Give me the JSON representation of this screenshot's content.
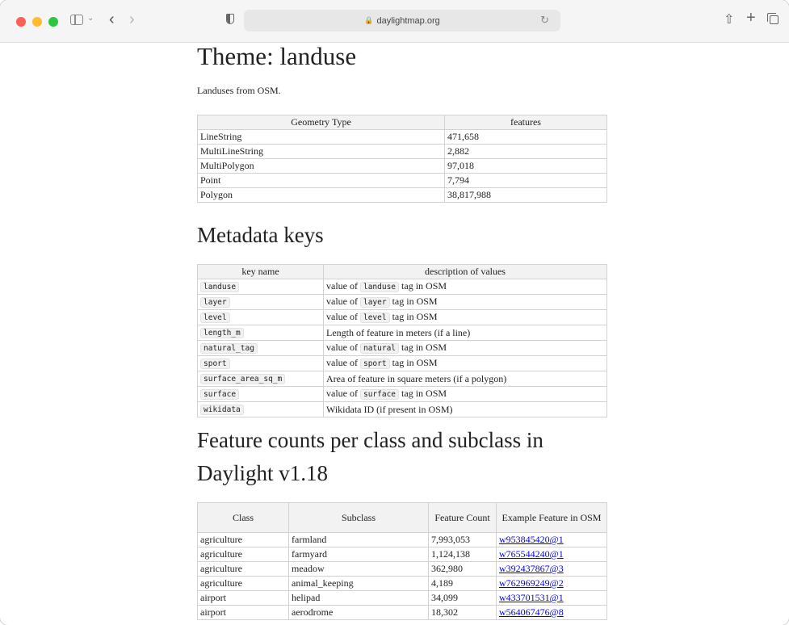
{
  "browser": {
    "url": "daylightmap.org"
  },
  "page": {
    "title": "Theme: landuse",
    "description": "Landuses from OSM.",
    "geometry_table": {
      "headers": [
        "Geometry Type",
        "features"
      ],
      "rows": [
        [
          "LineString",
          "471,658"
        ],
        [
          "MultiLineString",
          "2,882"
        ],
        [
          "MultiPolygon",
          "97,018"
        ],
        [
          "Point",
          "7,794"
        ],
        [
          "Polygon",
          "38,817,988"
        ]
      ]
    },
    "metadata_heading": "Metadata keys",
    "metadata_table": {
      "headers": [
        "key name",
        "description of values"
      ],
      "rows": [
        {
          "key": "landuse",
          "pre": "value of ",
          "code": "landuse",
          "post": " tag in OSM"
        },
        {
          "key": "layer",
          "pre": "value of ",
          "code": "layer",
          "post": " tag in OSM"
        },
        {
          "key": "level",
          "pre": "value of ",
          "code": "level",
          "post": " tag in OSM"
        },
        {
          "key": "length_m",
          "pre": "Length of feature in meters (if a line)",
          "code": "",
          "post": ""
        },
        {
          "key": "natural_tag",
          "pre": "value of ",
          "code": "natural",
          "post": " tag in OSM"
        },
        {
          "key": "sport",
          "pre": "value of ",
          "code": "sport",
          "post": " tag in OSM"
        },
        {
          "key": "surface_area_sq_m",
          "pre": "Area of feature in square meters (if a polygon)",
          "code": "",
          "post": ""
        },
        {
          "key": "surface",
          "pre": "value of ",
          "code": "surface",
          "post": " tag in OSM"
        },
        {
          "key": "wikidata",
          "pre": "Wikidata ID (if present in OSM)",
          "code": "",
          "post": ""
        }
      ]
    },
    "counts_heading": "Feature counts per class and subclass in Daylight v1.18",
    "counts_table": {
      "headers": [
        "Class",
        "Subclass",
        "Feature Count",
        "Example Feature in OSM"
      ],
      "rows": [
        [
          "agriculture",
          "farmland",
          "7,993,053",
          "w953845420@1"
        ],
        [
          "agriculture",
          "farmyard",
          "1,124,138",
          "w765544240@1"
        ],
        [
          "agriculture",
          "meadow",
          "362,980",
          "w392437867@3"
        ],
        [
          "agriculture",
          "animal_keeping",
          "4,189",
          "w762969249@2"
        ],
        [
          "airport",
          "helipad",
          "34,099",
          "w433701531@1"
        ],
        [
          "airport",
          "aerodrome",
          "18,302",
          "w564067476@8"
        ]
      ]
    }
  }
}
